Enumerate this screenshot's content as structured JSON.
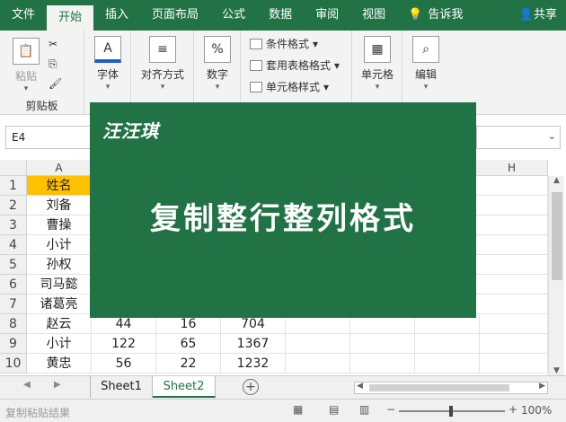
{
  "ribbon_tabs": [
    "文件",
    "开始",
    "插入",
    "页面布局",
    "公式",
    "数据",
    "审阅",
    "视图"
  ],
  "tell_me": "告诉我",
  "share": "共享",
  "clipboard": {
    "paste": "粘贴",
    "group": "剪贴板"
  },
  "font_btn": "字体",
  "align_btn": "对齐方式",
  "number_btn": "数字",
  "styles": {
    "conditional": "条件格式",
    "table": "套用表格格式",
    "cell": "单元格样式"
  },
  "cells_btn": "单元格",
  "edit_btn": "编辑",
  "name_box": "E4",
  "columns": [
    "A",
    "H"
  ],
  "rows": [
    "1",
    "2",
    "3",
    "4",
    "5",
    "6",
    "7",
    "8",
    "9",
    "10"
  ],
  "col_a": [
    "姓名",
    "刘备",
    "曹操",
    "小计",
    "孙权",
    "司马懿",
    "诸葛亮",
    "赵云",
    "小计",
    "黄忠"
  ],
  "row8": [
    "44",
    "16",
    "704"
  ],
  "row9": [
    "122",
    "65",
    "1367"
  ],
  "row10": [
    "56",
    "22",
    "1232"
  ],
  "sheets": [
    "Sheet1",
    "Sheet2"
  ],
  "zoom": "100%",
  "status_text": "复制粘贴结果",
  "overlay": {
    "brand": "汪汪琪",
    "title": "复制整行整列格式"
  },
  "colors": {
    "excel_green": "#217346",
    "header_yellow": "#ffc000"
  }
}
